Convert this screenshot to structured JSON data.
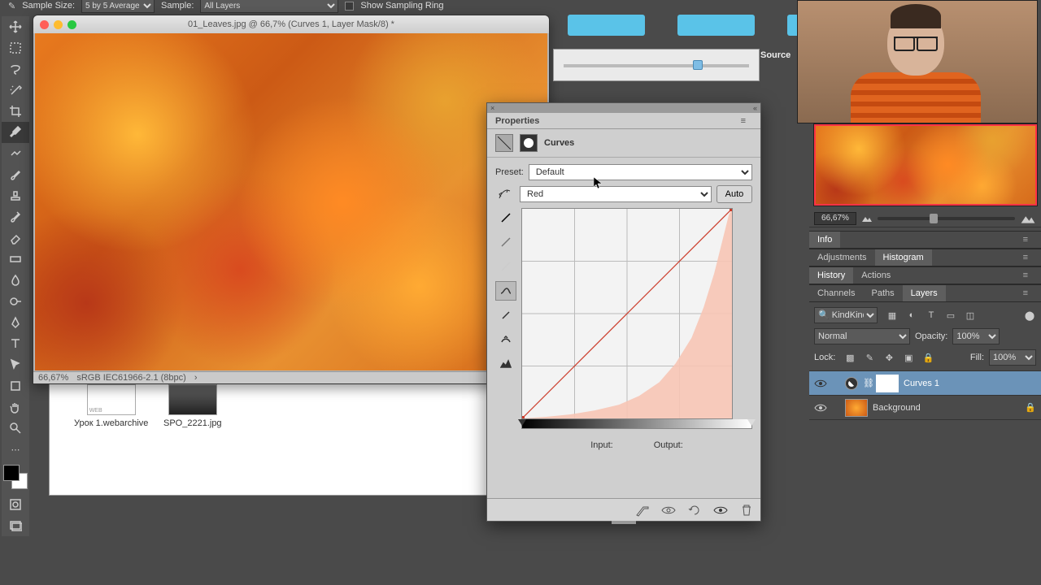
{
  "options": {
    "sample_size_label": "Sample Size:",
    "sample_size": "5 by 5 Average",
    "sample_label": "Sample:",
    "sample": "All Layers",
    "ring": "Show Sampling Ring"
  },
  "doc": {
    "title": "01_Leaves.jpg @ 66,7% (Curves 1, Layer Mask/8) *",
    "zoom": "66,67%",
    "profile": "sRGB IEC61966-2.1 (8bpc)"
  },
  "finder": {
    "f1": "Урок 1.webarchive",
    "f2": "SPO_2221.jpg"
  },
  "source": "Source",
  "props": {
    "title": "Properties",
    "type": "Curves",
    "preset_label": "Preset:",
    "preset": "Default",
    "channel": "Red",
    "auto": "Auto",
    "input": "Input:",
    "output": "Output:"
  },
  "nav": {
    "zoom": "66,67%"
  },
  "tabs": {
    "info": "Info",
    "adjustments": "Adjustments",
    "histogram": "Histogram",
    "history": "History",
    "actions": "Actions",
    "channels": "Channels",
    "paths": "Paths",
    "layers": "Layers"
  },
  "layers": {
    "kind": "Kind",
    "mode": "Normal",
    "opacity_label": "Opacity:",
    "opacity": "100%",
    "lock": "Lock:",
    "fill_label": "Fill:",
    "fill": "100%",
    "l1": "Curves 1",
    "l2": "Background"
  }
}
